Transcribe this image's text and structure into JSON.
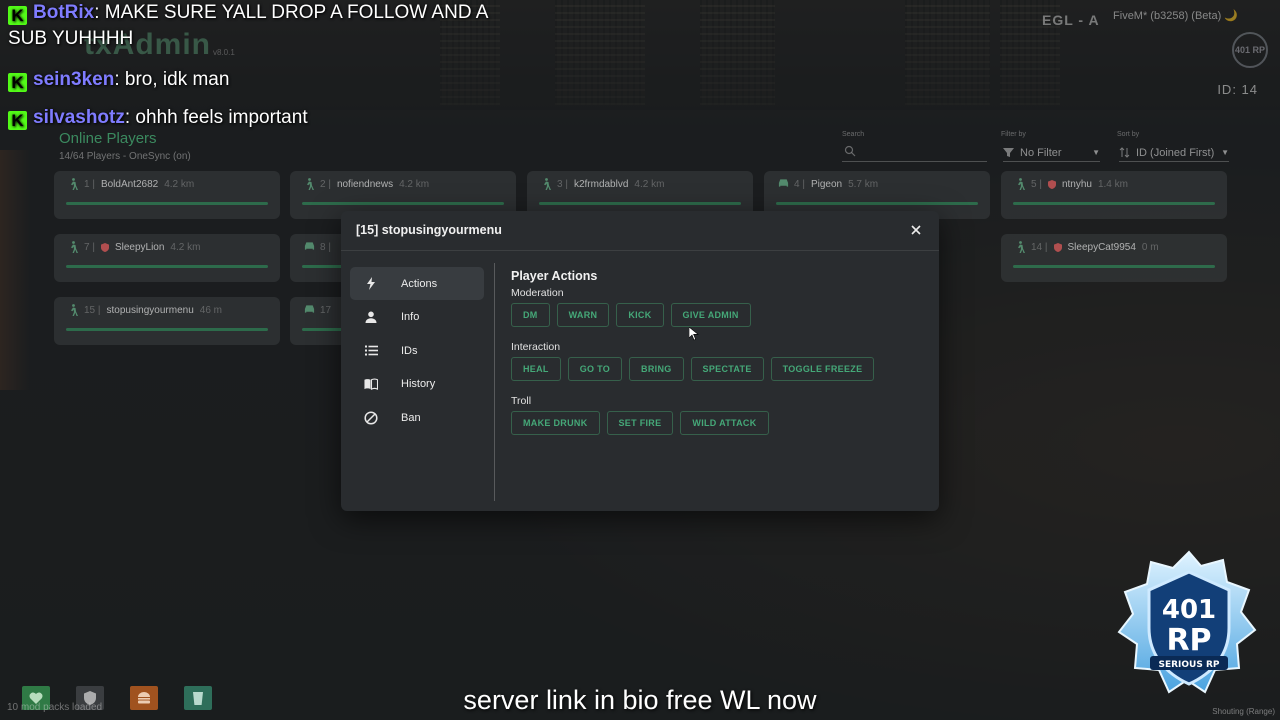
{
  "chat": [
    {
      "user": "BotRix",
      "message": ": MAKE SURE YALL DROP A FOLLOW AND A SUB YUHHHH"
    },
    {
      "user": "sein3ken",
      "message": ": bro, idk man"
    },
    {
      "user": "silvashotz",
      "message": ": ohhh feels important"
    }
  ],
  "txadmin": {
    "logo": "txAdmin",
    "version": "v8.0.1",
    "server": "FiveM* (b3258) (Beta) 🌙",
    "engine_tag": "EGL - A",
    "player_id": "ID: 14",
    "corner_badge": "401 RP",
    "online_title": "Online Players",
    "online_sub": "14/64 Players - OneSync (on)",
    "search_label": "Search",
    "search_placeholder": "",
    "filter_label": "Filter by",
    "filter_value": "No Filter",
    "sort_label": "Sort by",
    "sort_value": "ID (Joined First)"
  },
  "players": [
    {
      "num": "1 |",
      "name": "BoldAnt2682",
      "dist": "4.2 km",
      "icon": "walk-icon",
      "admin": false
    },
    {
      "num": "2 |",
      "name": "nofiendnews",
      "dist": "4.2 km",
      "icon": "walk-icon",
      "admin": false
    },
    {
      "num": "3 |",
      "name": "k2frmdablvd",
      "dist": "4.2 km",
      "icon": "walk-icon",
      "admin": false
    },
    {
      "num": "4 |",
      "name": "Pigeon",
      "dist": "5.7 km",
      "icon": "car-icon",
      "admin": false
    },
    {
      "num": "5 |",
      "name": "ntnyhu",
      "dist": "1.4 km",
      "icon": "walk-icon",
      "admin": true
    },
    {
      "num": "7 |",
      "name": "SleepyLion",
      "dist": "4.2 km",
      "icon": "walk-icon",
      "admin": true
    },
    {
      "num": "8 |",
      "name": "",
      "dist": "",
      "icon": "car-icon",
      "admin": false
    },
    {
      "num": "14 |",
      "name": "SleepyCat9954",
      "dist": "0 m",
      "icon": "walk-icon",
      "admin": true
    },
    {
      "num": "15 |",
      "name": "stopusingyourmenu",
      "dist": "46 m",
      "icon": "walk-icon",
      "admin": false
    },
    {
      "num": "17",
      "name": "",
      "dist": "",
      "icon": "car-icon",
      "admin": false
    }
  ],
  "modal": {
    "title": "[15] stopusingyourmenu",
    "menu": [
      {
        "label": "Actions",
        "icon": "lightning-icon",
        "active": true
      },
      {
        "label": "Info",
        "icon": "person-icon",
        "active": false
      },
      {
        "label": "IDs",
        "icon": "list-icon",
        "active": false
      },
      {
        "label": "History",
        "icon": "book-icon",
        "active": false
      },
      {
        "label": "Ban",
        "icon": "ban-icon",
        "active": false
      }
    ],
    "content_title": "Player Actions",
    "sections": [
      {
        "label": "Moderation",
        "buttons": [
          "DM",
          "WARN",
          "KICK",
          "GIVE ADMIN"
        ]
      },
      {
        "label": "Interaction",
        "buttons": [
          "HEAL",
          "GO TO",
          "BRING",
          "SPECTATE",
          "TOGGLE FREEZE"
        ]
      },
      {
        "label": "Troll",
        "buttons": [
          "MAKE DRUNK",
          "SET FIRE",
          "WILD ATTACK"
        ]
      }
    ]
  },
  "hud": {
    "status": "10 mod packs loaded",
    "subtitle": "server link in bio free WL now",
    "voice_mode": "Shouting (Range)"
  },
  "rp_logo": {
    "number": "401",
    "letters": "RP",
    "tagline": "SERIOUS RP"
  },
  "colors": {
    "accent": "#45a878",
    "kick_green": "#53fc18",
    "chat_user": "#7f7cff",
    "bar": "#2e7a53"
  }
}
